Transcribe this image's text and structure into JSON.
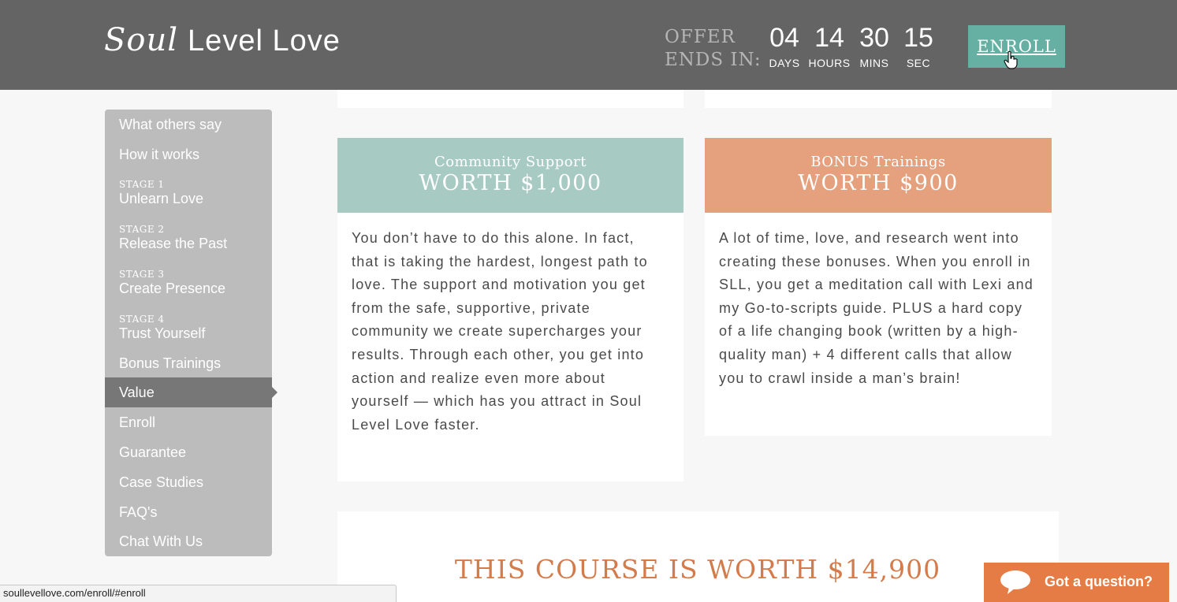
{
  "header": {
    "logo_script": "Soul",
    "logo_text": "Level Love",
    "offer_line1": "OFFER",
    "offer_line2": "ENDS IN:",
    "countdown": [
      {
        "value": "04",
        "label": "DAYS"
      },
      {
        "value": "14",
        "label": "HOURS"
      },
      {
        "value": "30",
        "label": "MINS"
      },
      {
        "value": "15",
        "label": "SEC"
      }
    ],
    "enroll_label": "ENROLL"
  },
  "sidebar": {
    "items": [
      {
        "label": "What others say"
      },
      {
        "label": "How it works"
      },
      {
        "stage": "STAGE 1",
        "label": "Unlearn Love"
      },
      {
        "stage": "STAGE 2",
        "label": "Release the Past"
      },
      {
        "stage": "STAGE 3",
        "label": "Create Presence"
      },
      {
        "stage": "STAGE 4",
        "label": "Trust Yourself"
      },
      {
        "label": "Bonus Trainings"
      },
      {
        "label": "Value",
        "active": true
      },
      {
        "label": "Enroll"
      },
      {
        "label": "Guarantee"
      },
      {
        "label": "Case Studies"
      },
      {
        "label": "FAQ's"
      },
      {
        "label": "Chat With Us"
      }
    ]
  },
  "cards": [
    {
      "subtitle": "Community Support",
      "worth": "WORTH $1,000",
      "body": "You don’t have to do this alone. In fact, that is taking the hardest, longest path to love. The support and motivation you get from the safe, supportive, private community we create supercharges your results. Through each other, you get into action and realize even more about yourself — which has you attract in Soul Level Love faster.",
      "color": "#a7cbc3"
    },
    {
      "subtitle": "BONUS Trainings",
      "worth": "WORTH $900",
      "body": "A lot of time, love, and research went into creating these bonuses. When you enroll in SLL, you get a meditation call with Lexi and my Go-to-scripts guide. PLUS a hard copy of a life changing book (written by a high-quality man) + 4 different calls that allow you to crawl inside a man’s brain!",
      "color": "#e5a07e"
    }
  ],
  "course_title": "THIS COURSE IS WORTH $14,900",
  "chat_label": "Got a question?",
  "status_url": "soullevellove.com/enroll/#enroll",
  "colors": {
    "header_bg": "#646464",
    "accent_teal": "#66b0a3",
    "accent_orange": "#e57b45",
    "sidebar_bg": "#bcbcbc",
    "sidebar_active": "#777777"
  }
}
